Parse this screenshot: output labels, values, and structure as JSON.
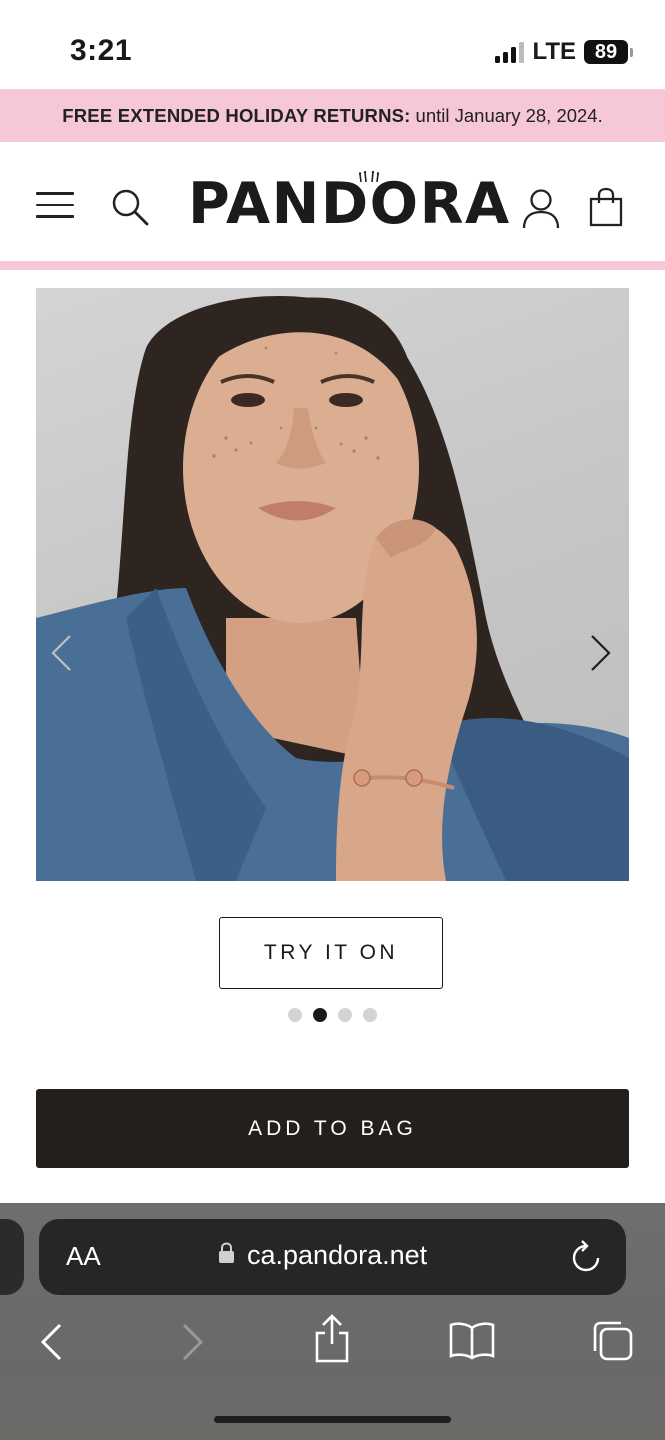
{
  "status_bar": {
    "time": "3:21",
    "network": "LTE",
    "battery_level": "89",
    "signal_bars": 3,
    "icons": [
      "signal-icon",
      "battery-icon"
    ]
  },
  "promo_banner": {
    "bold_text": "FREE EXTENDED HOLIDAY RETURNS:",
    "text": "until January 28, 2024.",
    "background_color": "#f6c7d4"
  },
  "header": {
    "logo_text": "PANDORA",
    "icons": [
      "menu-icon",
      "search-icon",
      "crown-icon",
      "user-icon",
      "bag-icon"
    ]
  },
  "product_gallery": {
    "image_alt": "Woman with freckles in denim jacket wearing rose gold open bangle",
    "slide_count": 4,
    "active_slide_index": 1,
    "icons": [
      "chevron-left-icon",
      "chevron-right-icon"
    ]
  },
  "try_on": {
    "label": "TRY IT ON"
  },
  "add_to_bag": {
    "label": "ADD TO BAG",
    "background_color": "#231f1c"
  },
  "browser": {
    "text_size_label": "AA",
    "url": "ca.pandora.net",
    "icons": [
      "lock-icon",
      "reload-icon",
      "back-icon",
      "forward-icon",
      "share-icon",
      "bookmarks-icon",
      "tabs-icon"
    ]
  }
}
